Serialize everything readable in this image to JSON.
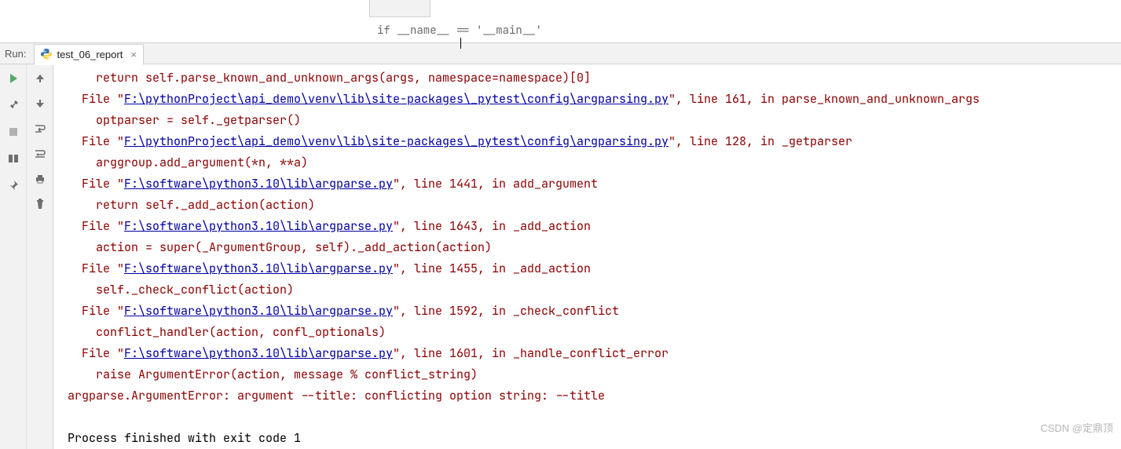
{
  "breadcrumb": "if __name__ == '__main__'",
  "run": {
    "label": "Run:",
    "tab_name": "test_06_report"
  },
  "traceback": {
    "line0": {
      "indent": 2,
      "text": "return self.parse_known_and_unknown_args(args, namespace=namespace)[0]"
    },
    "frames": [
      {
        "file_prefix": "  File \"",
        "path": "F:\\pythonProject\\api_demo\\venv\\lib\\site-packages\\_pytest\\config\\argparsing.py",
        "suffix": "\", line 161, in parse_known_and_unknown_args",
        "code": "optparser = self._getparser()"
      },
      {
        "file_prefix": "  File \"",
        "path": "F:\\pythonProject\\api_demo\\venv\\lib\\site-packages\\_pytest\\config\\argparsing.py",
        "suffix": "\", line 128, in _getparser",
        "code": "arggroup.add_argument(*n, **a)"
      },
      {
        "file_prefix": "  File \"",
        "path": "F:\\software\\python3.10\\lib\\argparse.py",
        "suffix": "\", line 1441, in add_argument",
        "code": "return self._add_action(action)"
      },
      {
        "file_prefix": "  File \"",
        "path": "F:\\software\\python3.10\\lib\\argparse.py",
        "suffix": "\", line 1643, in _add_action",
        "code": "action = super(_ArgumentGroup, self)._add_action(action)"
      },
      {
        "file_prefix": "  File \"",
        "path": "F:\\software\\python3.10\\lib\\argparse.py",
        "suffix": "\", line 1455, in _add_action",
        "code": "self._check_conflict(action)"
      },
      {
        "file_prefix": "  File \"",
        "path": "F:\\software\\python3.10\\lib\\argparse.py",
        "suffix": "\", line 1592, in _check_conflict",
        "code": "conflict_handler(action, confl_optionals)"
      },
      {
        "file_prefix": "  File \"",
        "path": "F:\\software\\python3.10\\lib\\argparse.py",
        "suffix": "\", line 1601, in _handle_conflict_error",
        "code": "raise ArgumentError(action, message % conflict_string)"
      }
    ],
    "error": "argparse.ArgumentError: argument --title: conflicting option string: --title",
    "exit": "Process finished with exit code 1"
  },
  "watermark": "CSDN @定鼎顶"
}
